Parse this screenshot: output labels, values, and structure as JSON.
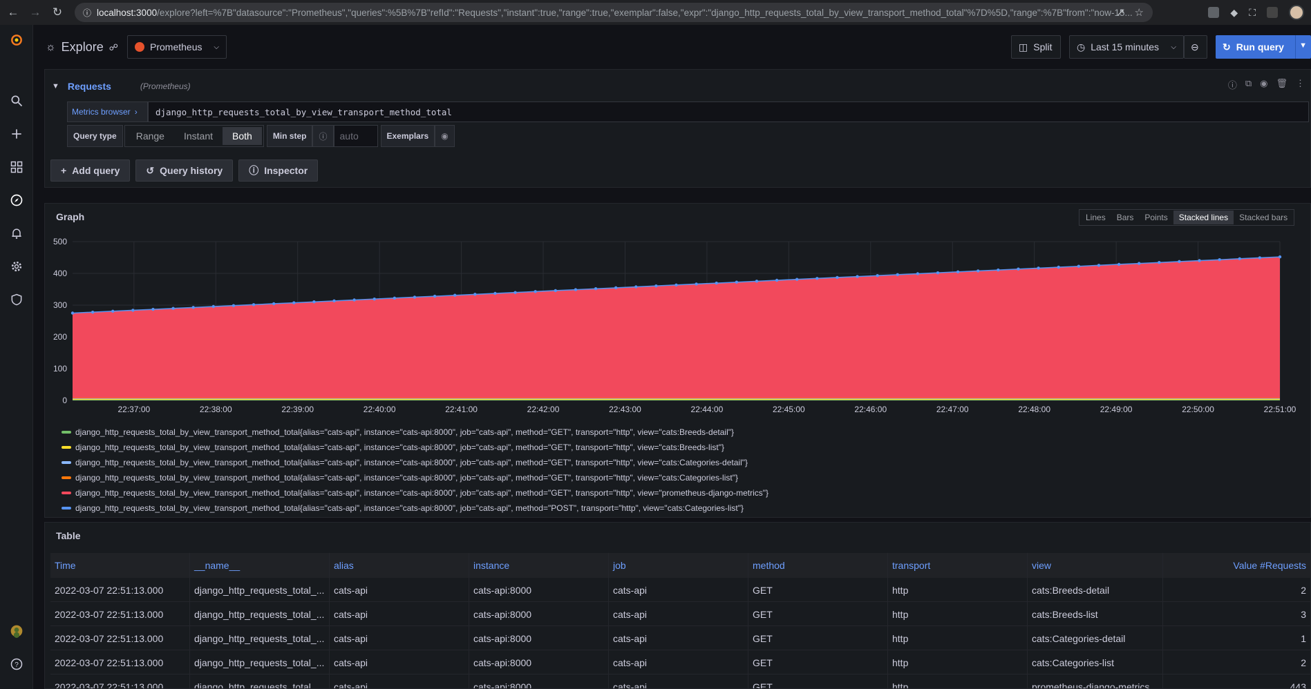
{
  "browser": {
    "url_host": "localhost:3000",
    "url_rest": "/explore?left=%7B\"datasource\":\"Prometheus\",\"queries\":%5B%7B\"refId\":\"Requests\",\"instant\":true,\"range\":true,\"exemplar\":false,\"expr\":\"django_http_requests_total_by_view_transport_method_total\"%7D%5D,\"range\":%7B\"from\":\"now-15..."
  },
  "topnav": {
    "title": "Explore",
    "datasource": "Prometheus",
    "split_label": "Split",
    "time_range": "Last 15 minutes",
    "run_query": "Run query"
  },
  "query": {
    "ref_id": "Requests",
    "datasource_hint": "(Prometheus)",
    "metrics_browser": "Metrics browser",
    "expr": "django_http_requests_total_by_view_transport_method_total",
    "query_type_label": "Query type",
    "query_types": [
      "Range",
      "Instant",
      "Both"
    ],
    "active_query_type": "Both",
    "min_step_label": "Min step",
    "min_step_placeholder": "auto",
    "exemplars_label": "Exemplars",
    "add_query": "Add query",
    "query_history": "Query history",
    "inspector": "Inspector"
  },
  "graph": {
    "title": "Graph",
    "vis_options": [
      "Lines",
      "Bars",
      "Points",
      "Stacked lines",
      "Stacked bars"
    ],
    "active_vis": "Stacked lines"
  },
  "chart_data": {
    "type": "area",
    "stacked": true,
    "title": "",
    "xlabel": "",
    "ylabel": "",
    "ylim": [
      0,
      500
    ],
    "yticks": [
      0,
      100,
      200,
      300,
      400,
      500
    ],
    "xticks": [
      "22:37:00",
      "22:38:00",
      "22:39:00",
      "22:40:00",
      "22:41:00",
      "22:42:00",
      "22:43:00",
      "22:44:00",
      "22:45:00",
      "22:46:00",
      "22:47:00",
      "22:48:00",
      "22:49:00",
      "22:50:00",
      "22:51:00"
    ],
    "x_start": "22:36:15",
    "x_end": "22:51:00",
    "grid": true,
    "legend_position": "bottom",
    "series": [
      {
        "name": "django_http_requests_total_by_view_transport_method_total{alias=\"cats-api\", instance=\"cats-api:8000\", job=\"cats-api\", method=\"GET\", transport=\"http\", view=\"cats:Breeds-detail\"}",
        "color": "#73bf69",
        "start": 2,
        "end": 2
      },
      {
        "name": "django_http_requests_total_by_view_transport_method_total{alias=\"cats-api\", instance=\"cats-api:8000\", job=\"cats-api\", method=\"GET\", transport=\"http\", view=\"cats:Breeds-list\"}",
        "color": "#fade2a",
        "start": 3,
        "end": 3
      },
      {
        "name": "django_http_requests_total_by_view_transport_method_total{alias=\"cats-api\", instance=\"cats-api:8000\", job=\"cats-api\", method=\"GET\", transport=\"http\", view=\"cats:Categories-detail\"}",
        "color": "#8ab8ff",
        "start": 1,
        "end": 1
      },
      {
        "name": "django_http_requests_total_by_view_transport_method_total{alias=\"cats-api\", instance=\"cats-api:8000\", job=\"cats-api\", method=\"GET\", transport=\"http\", view=\"cats:Categories-list\"}",
        "color": "#ff780a",
        "start": 2,
        "end": 2
      },
      {
        "name": "django_http_requests_total_by_view_transport_method_total{alias=\"cats-api\", instance=\"cats-api:8000\", job=\"cats-api\", method=\"GET\", transport=\"http\", view=\"prometheus-django-metrics\"}",
        "color": "#f2495c",
        "start": 266,
        "end": 443
      },
      {
        "name": "django_http_requests_total_by_view_transport_method_total{alias=\"cats-api\", instance=\"cats-api:8000\", job=\"cats-api\", method=\"POST\", transport=\"http\", view=\"cats:Categories-list\"}",
        "color": "#5794f2",
        "start": 1,
        "end": 1
      }
    ]
  },
  "table": {
    "title": "Table",
    "columns": [
      "Time",
      "__name__",
      "alias",
      "instance",
      "job",
      "method",
      "transport",
      "view",
      "Value #Requests"
    ],
    "rows": [
      [
        "2022-03-07 22:51:13.000",
        "django_http_requests_total_...",
        "cats-api",
        "cats-api:8000",
        "cats-api",
        "GET",
        "http",
        "cats:Breeds-detail",
        "2"
      ],
      [
        "2022-03-07 22:51:13.000",
        "django_http_requests_total_...",
        "cats-api",
        "cats-api:8000",
        "cats-api",
        "GET",
        "http",
        "cats:Breeds-list",
        "3"
      ],
      [
        "2022-03-07 22:51:13.000",
        "django_http_requests_total_...",
        "cats-api",
        "cats-api:8000",
        "cats-api",
        "GET",
        "http",
        "cats:Categories-detail",
        "1"
      ],
      [
        "2022-03-07 22:51:13.000",
        "django_http_requests_total_...",
        "cats-api",
        "cats-api:8000",
        "cats-api",
        "GET",
        "http",
        "cats:Categories-list",
        "2"
      ],
      [
        "2022-03-07 22:51:13.000",
        "django_http_requests_total_...",
        "cats-api",
        "cats-api:8000",
        "cats-api",
        "GET",
        "http",
        "prometheus-django-metrics",
        "443"
      ]
    ]
  }
}
